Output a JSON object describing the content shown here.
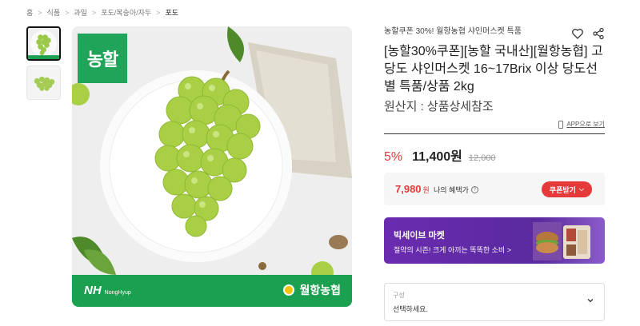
{
  "breadcrumb": {
    "items": [
      "홈",
      "식품",
      "과일",
      "포도/복숭아/자두",
      "포도"
    ],
    "separator": ">"
  },
  "gallery": {
    "thumbnails": [
      "grape-thumb-1",
      "grape-thumb-2"
    ],
    "badge_text": "농할",
    "nh_logo": "NH",
    "nh_sub": "NongHyup",
    "partner_logo": "월항농협"
  },
  "product": {
    "promo_line": "농할쿠폰 30%! 월항농협 샤인머스켓 특품",
    "title": "[농할30%쿠폰][농할 국내산][월항농협] 고당도 샤인머스켓 16~17Brix 이상 당도선별 특품/상품 2kg",
    "origin": "원산지 : 상품상세참조",
    "app_view_label": "APP으로 보기"
  },
  "price": {
    "discount": "5%",
    "sale_price": "11,400원",
    "original_price": "12,000"
  },
  "benefit": {
    "price": "7,980",
    "unit": "원",
    "label": "나의 혜택가",
    "coupon_button": "쿠폰받기"
  },
  "bigsave": {
    "title": "빅세이브 마켓",
    "subtitle": "절약의 시즌! 크게 아끼는 똑똑한 소비 >"
  },
  "option": {
    "label": "구성",
    "placeholder": "선택하세요."
  },
  "colors": {
    "brand_green": "#1fa45a",
    "price_red": "#e43a3a",
    "bigsave_purple": "#6a2bb0"
  },
  "icons": [
    "heart-icon",
    "share-icon",
    "phone-icon",
    "question-icon",
    "chevron-down-icon"
  ]
}
